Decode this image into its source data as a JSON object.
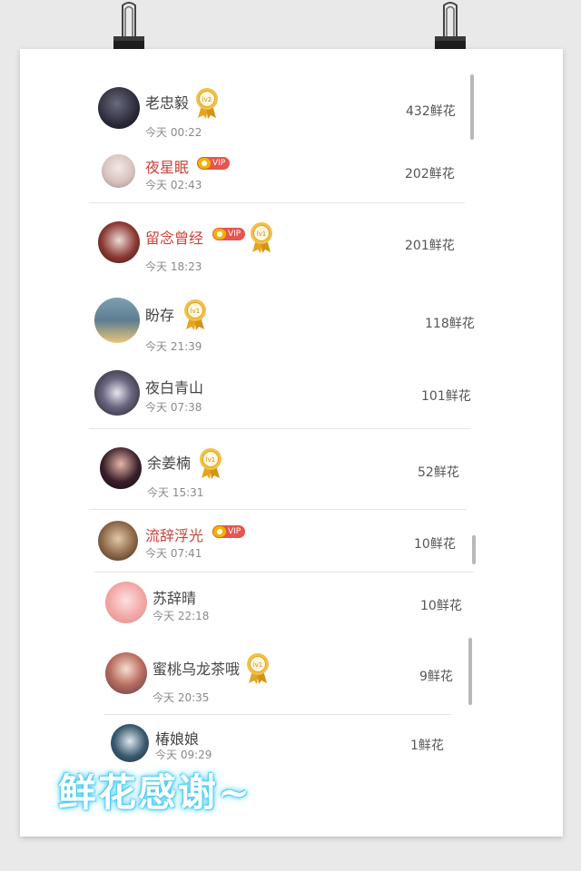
{
  "rows": [
    {
      "name": "老忠毅",
      "time": "今天 00:22",
      "flowers": "432鲜花",
      "vip": false,
      "level": "lv2"
    },
    {
      "name": "夜星眠",
      "time": "今天 02:43",
      "flowers": "202鲜花",
      "vip": true,
      "vip_label": "VIP",
      "level": null
    },
    {
      "name": "留念曾经",
      "time": "今天 18:23",
      "flowers": "201鲜花",
      "vip": true,
      "vip_label": "VIP",
      "level": "lv1"
    },
    {
      "name": "盼存",
      "time": "今天 21:39",
      "flowers": "118鲜花",
      "vip": false,
      "level": "lv1"
    },
    {
      "name": "夜白青山",
      "time": "今天 07:38",
      "flowers": "101鲜花",
      "vip": false,
      "level": null
    },
    {
      "name": "余姜楠",
      "time": "今天 15:31",
      "flowers": "52鲜花",
      "vip": false,
      "level": "lv1"
    },
    {
      "name": "流辞浮光",
      "time": "今天 07:41",
      "flowers": "10鲜花",
      "vip": true,
      "vip_label": "VIP",
      "level": null
    },
    {
      "name": "苏辞晴",
      "time": "今天 22:18",
      "flowers": "10鲜花",
      "vip": false,
      "level": null
    },
    {
      "name": "蜜桃乌龙茶哦",
      "time": "今天 20:35",
      "flowers": "9鲜花",
      "vip": false,
      "level": "lv1"
    },
    {
      "name": "椿娘娘",
      "time": "今天 09:29",
      "flowers": "1鲜花",
      "vip": false,
      "level": null
    }
  ],
  "footer_text": "鲜花感谢~",
  "colors": {
    "vip_name": "#c8443a",
    "vip_badge": "#e8544e",
    "medal_gold": "#e2a623",
    "glow": "#3fc9f5"
  },
  "icons": {
    "binder_clip": "binder-clip-icon",
    "medal": "medal-icon",
    "vip": "vip-badge-icon"
  }
}
